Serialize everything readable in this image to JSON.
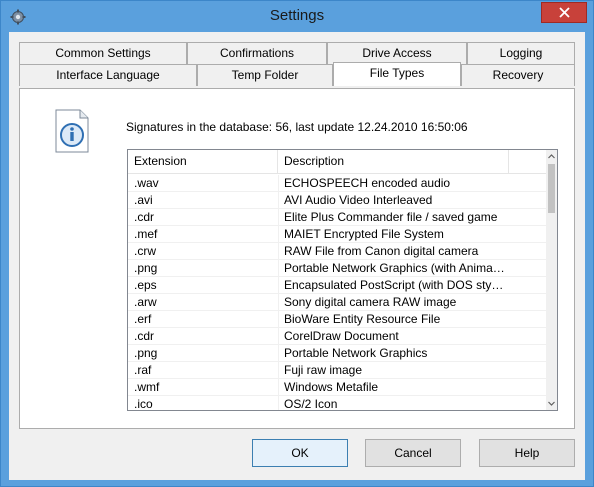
{
  "window": {
    "title": "Settings",
    "close_glyph": "×"
  },
  "tabs": {
    "row1": [
      {
        "label": "Common Settings"
      },
      {
        "label": "Confirmations"
      },
      {
        "label": "Drive Access"
      },
      {
        "label": "Logging"
      }
    ],
    "row2": [
      {
        "label": "Interface Language"
      },
      {
        "label": "Temp Folder"
      },
      {
        "label": "File Types",
        "active": true
      },
      {
        "label": "Recovery"
      }
    ]
  },
  "panel": {
    "info_icon": "info-icon",
    "signatures_text": "Signatures in the database: 56, last update 12.24.2010 16:50:06"
  },
  "list": {
    "columns": [
      "Extension",
      "Description"
    ],
    "rows": [
      {
        "ext": ".wav",
        "desc": "ECHOSPEECH encoded audio"
      },
      {
        "ext": ".avi",
        "desc": "AVI Audio Video Interleaved"
      },
      {
        "ext": ".cdr",
        "desc": "Elite Plus Commander file / saved game"
      },
      {
        "ext": ".mef",
        "desc": "MAIET Encrypted File System"
      },
      {
        "ext": ".crw",
        "desc": "RAW File from Canon digital camera"
      },
      {
        "ext": ".png",
        "desc": "Portable Network Graphics (with Animation)"
      },
      {
        "ext": ".eps",
        "desc": "Encapsulated PostScript (with DOS style pre..."
      },
      {
        "ext": ".arw",
        "desc": "Sony digital camera RAW image"
      },
      {
        "ext": ".erf",
        "desc": "BioWare Entity Resource File"
      },
      {
        "ext": ".cdr",
        "desc": "CorelDraw Document"
      },
      {
        "ext": ".png",
        "desc": "Portable Network Graphics"
      },
      {
        "ext": ".raf",
        "desc": "Fuji raw image"
      },
      {
        "ext": ".wmf",
        "desc": "Windows Metafile"
      },
      {
        "ext": ".ico",
        "desc": "OS/2 Icon"
      }
    ]
  },
  "buttons": {
    "ok": "OK",
    "cancel": "Cancel",
    "help": "Help"
  },
  "colors": {
    "titlebar": "#5aa0dd",
    "close": "#c8413a",
    "default_button": "#e5f1fb"
  }
}
